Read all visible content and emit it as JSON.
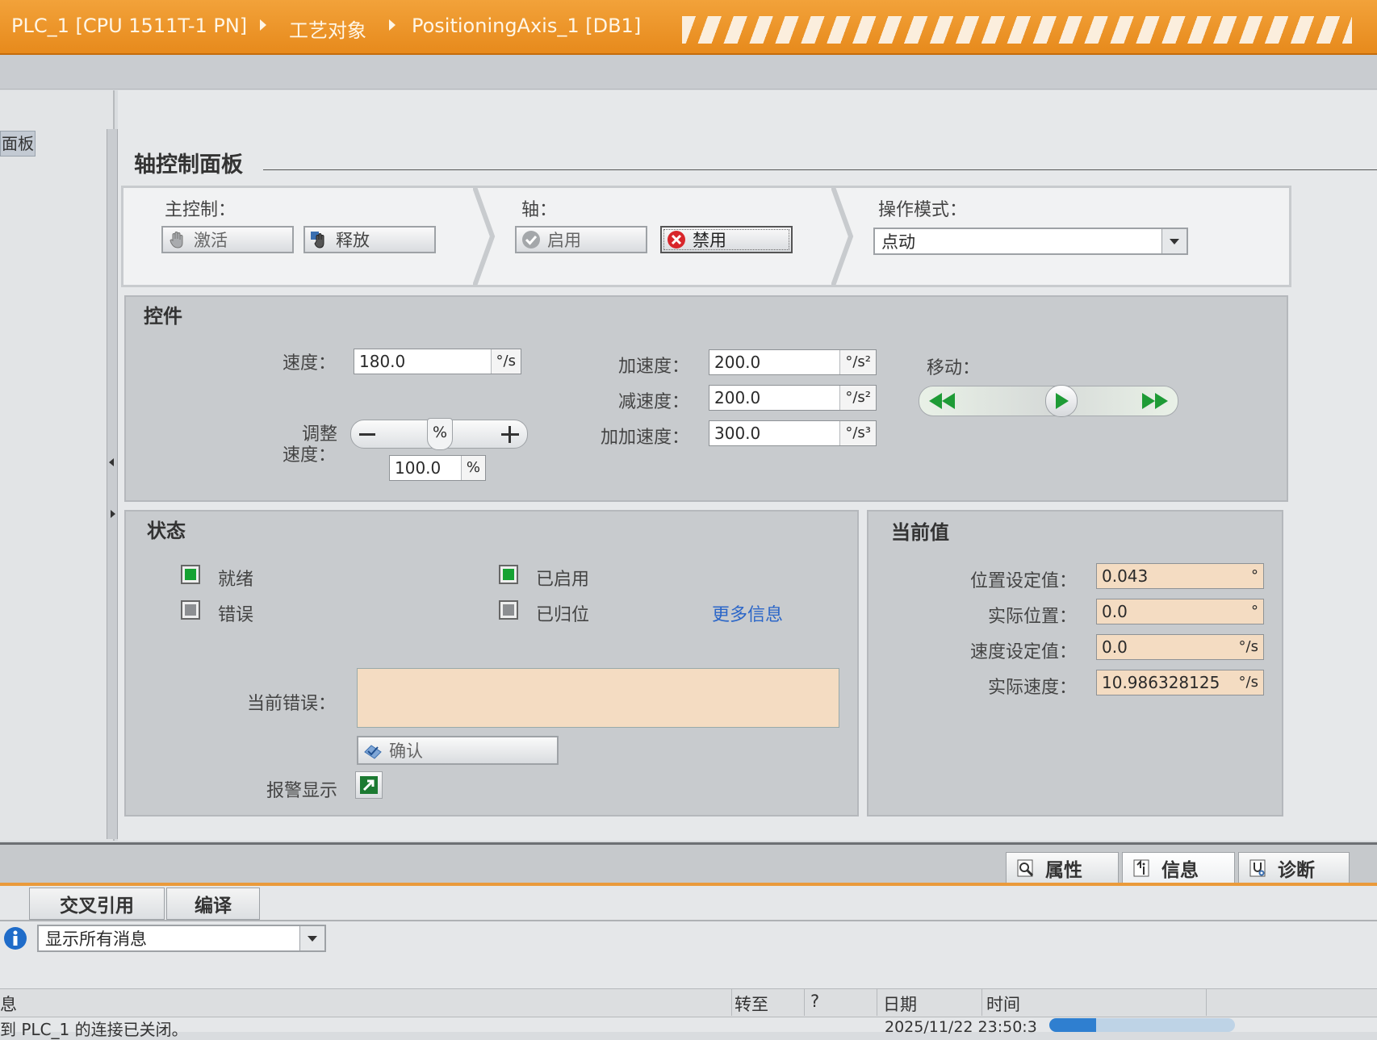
{
  "breadcrumb": {
    "device": "PLC_1 [CPU 1511T-1 PN]",
    "folder": "工艺对象",
    "object": "PositioningAxis_1 [DB1]"
  },
  "left_tab": "面板",
  "panel": {
    "title": "轴控制面板"
  },
  "master_control": {
    "label": "主控制：",
    "activate": "激活",
    "release": "释放"
  },
  "axis": {
    "label": "轴：",
    "enable": "启用",
    "disable": "禁用"
  },
  "operating_mode": {
    "label": "操作模式：",
    "value": "点动"
  },
  "controls": {
    "title": "控件",
    "speed_label": "速度：",
    "speed_value": "180.0",
    "speed_unit": "°/s",
    "override_label_1": "调整",
    "override_label_2": "速度：",
    "override_slider_unit": "%",
    "override_value": "100.0",
    "override_unit": "%",
    "override_fraction": 0.5,
    "accel_label": "加速度：",
    "accel_value": "200.0",
    "accel_unit": "°/s²",
    "decel_label": "减速度：",
    "decel_value": "200.0",
    "decel_unit": "°/s²",
    "jerk_label": "加加速度：",
    "jerk_value": "300.0",
    "jerk_unit": "°/s³",
    "move_label": "移动："
  },
  "status": {
    "title": "状态",
    "ready": "就绪",
    "ready_on": true,
    "error": "错误",
    "error_on": false,
    "enabled": "已启用",
    "enabled_on": true,
    "homed": "已归位",
    "homed_on": false,
    "more_info": "更多信息",
    "current_error_label": "当前错误：",
    "current_error_value": "",
    "acknowledge": "确认",
    "alarm_display_label": "报警显示"
  },
  "current_values": {
    "title": "当前值",
    "pos_setpoint_label": "位置设定值：",
    "pos_setpoint_value": "0.043",
    "pos_setpoint_unit": "°",
    "actual_pos_label": "实际位置：",
    "actual_pos_value": "0.0",
    "actual_pos_unit": "°",
    "vel_setpoint_label": "速度设定值：",
    "vel_setpoint_value": "0.0",
    "vel_setpoint_unit": "°/s",
    "actual_vel_label": "实际速度：",
    "actual_vel_value": "10.986328125",
    "actual_vel_unit": "°/s"
  },
  "inspector_tabs": {
    "properties": "属性",
    "info": "信息",
    "diagnostics": "诊断"
  },
  "info_tabs": {
    "cross_ref": "交叉引用",
    "compile": "编译"
  },
  "message_filter": "显示所有消息",
  "message_table": {
    "col_message": "息",
    "col_goto": "转至",
    "col_q": "?",
    "col_date": "日期",
    "col_time": "时间"
  },
  "message_row": {
    "text": "到 PLC_1 的连接已关闭。",
    "datetime": "2025/11/22  23:50:3"
  },
  "progress": 0.25,
  "colors": {
    "accent_orange": "#e78a1c",
    "status_green": "#16a233",
    "readonly_field": "#f4dcc2",
    "link_blue": "#2b66c8"
  }
}
